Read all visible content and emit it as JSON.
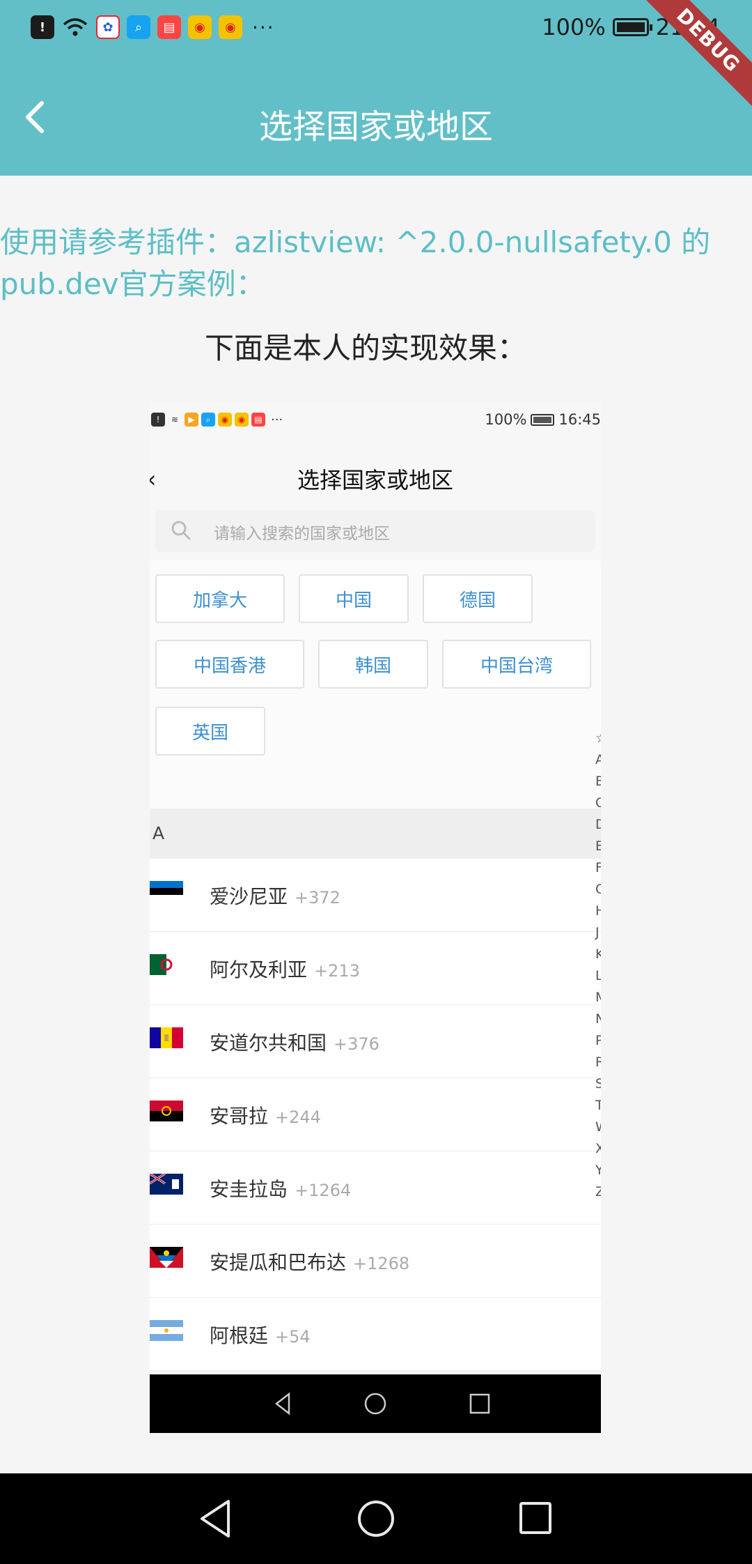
{
  "status_bar": {
    "battery": "100%",
    "time": "21:54",
    "more": "···"
  },
  "debug_banner": "DEBUG",
  "app_bar": {
    "title": "选择国家或地区"
  },
  "intro_text": "使用请参考插件：azlistview: ^2.0.0-nullsafety.0 的pub.dev官方案例：",
  "subtitle": "下面是本人的实现效果：",
  "example": {
    "status": {
      "battery": "100%",
      "time": "16:45",
      "more": "···"
    },
    "title": "选择国家或地区",
    "search_placeholder": "请输入搜索的国家或地区",
    "hot_countries": [
      "加拿大",
      "中国",
      "德国",
      "中国香港",
      "韩国",
      "中国台湾",
      "英国"
    ],
    "section_letter": "A",
    "countries": [
      {
        "name": "爱沙尼亚",
        "code": "+372",
        "flag": "estonia-flag"
      },
      {
        "name": "阿尔及利亚",
        "code": "+213",
        "flag": "algeria-flag"
      },
      {
        "name": "安道尔共和国",
        "code": "+376",
        "flag": "andorra-flag"
      },
      {
        "name": "安哥拉",
        "code": "+244",
        "flag": "angola-flag"
      },
      {
        "name": "安圭拉岛",
        "code": "+1264",
        "flag": "anguilla-flag"
      },
      {
        "name": "安提瓜和巴布达",
        "code": "+1268",
        "flag": "antigua-flag"
      },
      {
        "name": "阿根廷",
        "code": "+54",
        "flag": "argentina-flag"
      }
    ],
    "index_letters": [
      "☆",
      "A",
      "B",
      "C",
      "D",
      "E",
      "F",
      "G",
      "H",
      "J",
      "K",
      "L",
      "M",
      "N",
      "P",
      "R",
      "S",
      "T",
      "W",
      "X",
      "Y",
      "Z"
    ]
  },
  "colors": {
    "primary": "#62bfc7",
    "link": "#5cbec6",
    "chip_text": "#3c8fd0"
  }
}
